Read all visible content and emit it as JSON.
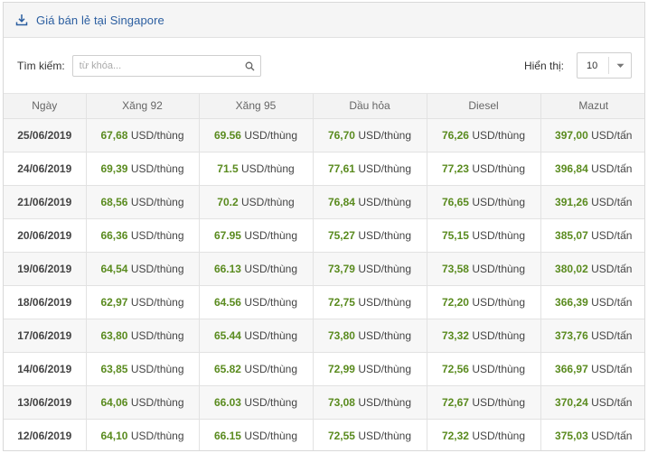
{
  "header": {
    "title": "Giá bán lẻ tại Singapore",
    "icon": "download-icon"
  },
  "toolbar": {
    "search_label": "Tìm kiếm:",
    "search_placeholder": "từ khóa...",
    "show_label": "Hiển thị:",
    "page_size": "10"
  },
  "colors": {
    "title": "#2b5ea0",
    "value": "#5a8b1f"
  },
  "table": {
    "columns": [
      "Ngày",
      "Xăng 92",
      "Xăng 95",
      "Dầu hỏa",
      "Diesel",
      "Mazut"
    ],
    "rows": [
      {
        "date": "25/06/2019",
        "x92": "67,68",
        "x92_unit": "USD/thùng",
        "x95": "69.56",
        "x95_unit": "USD/thùng",
        "dau": "76,70",
        "dau_unit": "USD/thùng",
        "diesel": "76,26",
        "diesel_unit": "USD/thùng",
        "mazut": "397,00",
        "mazut_unit": "USD/tấn"
      },
      {
        "date": "24/06/2019",
        "x92": "69,39",
        "x92_unit": "USD/thùng",
        "x95": "71.5",
        "x95_unit": "USD/thùng",
        "dau": "77,61",
        "dau_unit": "USD/thùng",
        "diesel": "77,23",
        "diesel_unit": "USD/thùng",
        "mazut": "396,84",
        "mazut_unit": "USD/tấn"
      },
      {
        "date": "21/06/2019",
        "x92": "68,56",
        "x92_unit": "USD/thùng",
        "x95": "70.2",
        "x95_unit": "USD/thùng",
        "dau": "76,84",
        "dau_unit": "USD/thùng",
        "diesel": "76,65",
        "diesel_unit": "USD/thùng",
        "mazut": "391,26",
        "mazut_unit": "USD/tấn"
      },
      {
        "date": "20/06/2019",
        "x92": "66,36",
        "x92_unit": "USD/thùng",
        "x95": "67.95",
        "x95_unit": "USD/thùng",
        "dau": "75,27",
        "dau_unit": "USD/thùng",
        "diesel": "75,15",
        "diesel_unit": "USD/thùng",
        "mazut": "385,07",
        "mazut_unit": "USD/tấn"
      },
      {
        "date": "19/06/2019",
        "x92": "64,54",
        "x92_unit": "USD/thùng",
        "x95": "66.13",
        "x95_unit": "USD/thùng",
        "dau": "73,79",
        "dau_unit": "USD/thùng",
        "diesel": "73,58",
        "diesel_unit": "USD/thùng",
        "mazut": "380,02",
        "mazut_unit": "USD/tấn"
      },
      {
        "date": "18/06/2019",
        "x92": "62,97",
        "x92_unit": "USD/thùng",
        "x95": "64.56",
        "x95_unit": "USD/thùng",
        "dau": "72,75",
        "dau_unit": "USD/thùng",
        "diesel": "72,20",
        "diesel_unit": "USD/thùng",
        "mazut": "366,39",
        "mazut_unit": "USD/tấn"
      },
      {
        "date": "17/06/2019",
        "x92": "63,80",
        "x92_unit": "USD/thùng",
        "x95": "65.44",
        "x95_unit": "USD/thùng",
        "dau": "73,80",
        "dau_unit": "USD/thùng",
        "diesel": "73,32",
        "diesel_unit": "USD/thùng",
        "mazut": "373,76",
        "mazut_unit": "USD/tấn"
      },
      {
        "date": "14/06/2019",
        "x92": "63,85",
        "x92_unit": "USD/thùng",
        "x95": "65.82",
        "x95_unit": "USD/thùng",
        "dau": "72,99",
        "dau_unit": "USD/thùng",
        "diesel": "72,56",
        "diesel_unit": "USD/thùng",
        "mazut": "366,97",
        "mazut_unit": "USD/tấn"
      },
      {
        "date": "13/06/2019",
        "x92": "64,06",
        "x92_unit": "USD/thùng",
        "x95": "66.03",
        "x95_unit": "USD/thùng",
        "dau": "73,08",
        "dau_unit": "USD/thùng",
        "diesel": "72,67",
        "diesel_unit": "USD/thùng",
        "mazut": "370,24",
        "mazut_unit": "USD/tấn"
      },
      {
        "date": "12/06/2019",
        "x92": "64,10",
        "x92_unit": "USD/thùng",
        "x95": "66.15",
        "x95_unit": "USD/thùng",
        "dau": "72,55",
        "dau_unit": "USD/thùng",
        "diesel": "72,32",
        "diesel_unit": "USD/thùng",
        "mazut": "375,03",
        "mazut_unit": "USD/tấn"
      }
    ]
  }
}
